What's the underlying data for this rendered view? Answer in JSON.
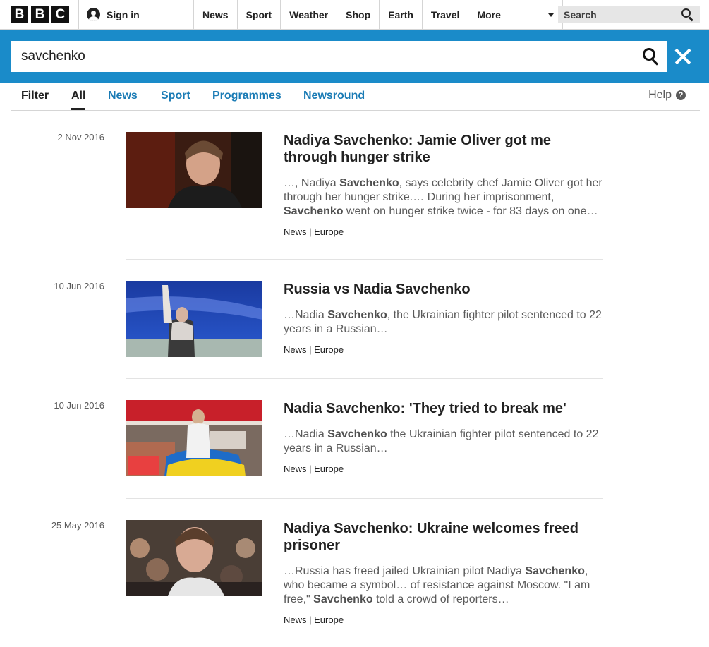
{
  "header": {
    "logo": [
      "B",
      "B",
      "C"
    ],
    "signin": "Sign in",
    "nav": [
      "News",
      "Sport",
      "Weather",
      "Shop",
      "Earth",
      "Travel"
    ],
    "more": "More",
    "search_placeholder": "Search"
  },
  "search": {
    "query": "savchenko"
  },
  "filters": {
    "label": "Filter",
    "tabs": [
      "All",
      "News",
      "Sport",
      "Programmes",
      "Newsround"
    ],
    "active": "All",
    "help": "Help",
    "help_icon": "?"
  },
  "results": [
    {
      "date": "2 Nov 2016",
      "title": "Nadiya Savchenko: Jamie Oliver got me through hunger strike",
      "snippet": [
        {
          "t": "…, Nadiya "
        },
        {
          "t": "Savchenko",
          "b": true
        },
        {
          "t": ", says celebrity chef Jamie Oliver got her through her hunger strike.… During her imprisonment, "
        },
        {
          "t": "Savchenko",
          "b": true
        },
        {
          "t": " went on hunger strike twice - for 83 days on one…"
        }
      ],
      "section": "News",
      "subsection": "Europe"
    },
    {
      "date": "10 Jun 2016",
      "title": "Russia vs Nadia Savchenko",
      "snippet": [
        {
          "t": "…Nadia "
        },
        {
          "t": "Savchenko",
          "b": true
        },
        {
          "t": ", the Ukrainian fighter pilot sentenced to 22 years in a Russian…"
        }
      ],
      "section": "News",
      "subsection": "Europe"
    },
    {
      "date": "10 Jun 2016",
      "title": "Nadia Savchenko: 'They tried to break me'",
      "snippet": [
        {
          "t": "…Nadia "
        },
        {
          "t": "Savchenko",
          "b": true
        },
        {
          "t": " the Ukrainian fighter pilot sentenced to 22 years in a Russian…"
        }
      ],
      "section": "News",
      "subsection": "Europe"
    },
    {
      "date": "25 May 2016",
      "title": "Nadiya Savchenko: Ukraine welcomes freed prisoner",
      "snippet": [
        {
          "t": "…Russia has freed jailed Ukrainian pilot Nadiya "
        },
        {
          "t": "Savchenko",
          "b": true
        },
        {
          "t": ", who became a symbol… of resistance against Moscow. \"I am free,\" "
        },
        {
          "t": "Savchenko",
          "b": true
        },
        {
          "t": " told a crowd of reporters…"
        }
      ],
      "section": "News",
      "subsection": "Europe"
    }
  ],
  "colors": {
    "brand_blue": "#1a8bc9",
    "link_blue": "#1a7bb5"
  }
}
